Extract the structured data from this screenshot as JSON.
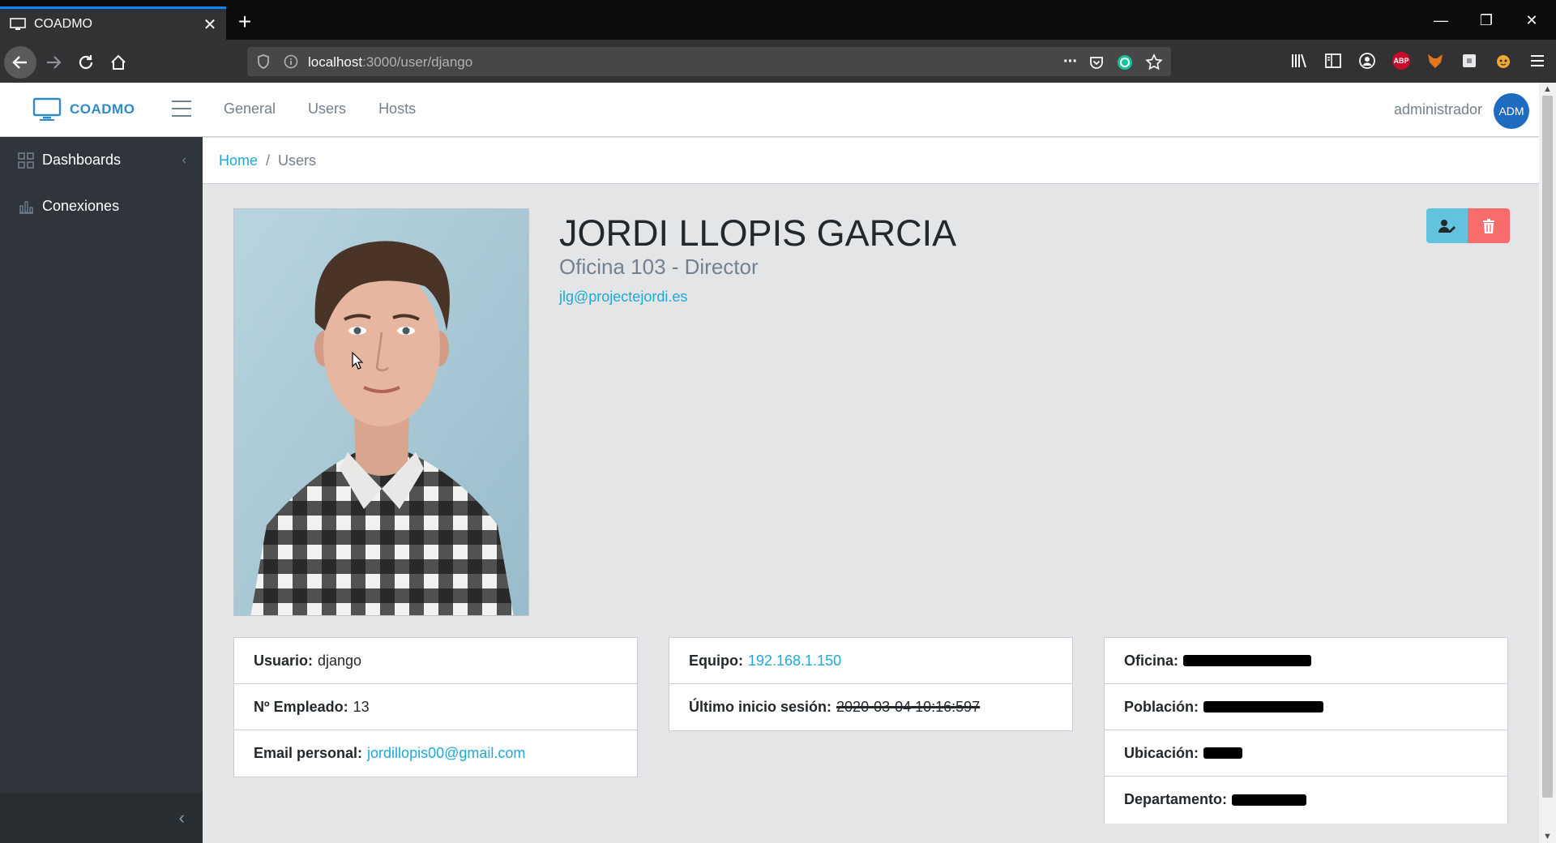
{
  "browser": {
    "tab_title": "COADMO",
    "tab_close": "✕",
    "new_tab": "+",
    "url_host": "localhost",
    "url_path": ":3000/user/django",
    "url_more": "···",
    "abp_label": "ABP",
    "window_minimize": "—",
    "window_restore": "❐",
    "window_close": "✕"
  },
  "header": {
    "brand": "COADMO",
    "nav": [
      "General",
      "Users",
      "Hosts"
    ],
    "user_name": "administrador",
    "avatar_initials": "ADM"
  },
  "sidebar": {
    "items": [
      {
        "label": "Dashboards",
        "icon": "grid-icon",
        "caret": "‹"
      },
      {
        "label": "Conexiones",
        "icon": "bar-chart-icon"
      }
    ],
    "collapse": "‹"
  },
  "breadcrumb": {
    "home": "Home",
    "separator": "/",
    "current": "Users"
  },
  "profile": {
    "name": "JORDI LLOPIS GARCIA",
    "role": "Oficina 103 - Director",
    "email": "jlg@projectejordi.es"
  },
  "cards": {
    "personal": {
      "usuario_label": "Usuario:",
      "usuario_value": "django",
      "empleado_label": "Nº Empleado:",
      "empleado_value": "13",
      "email_label": "Email personal:",
      "email_value": "jordillopis00@gmail.com"
    },
    "equipo": {
      "equipo_label": "Equipo:",
      "equipo_value": "192.168.1.150",
      "sesion_label": "Último inicio sesión:",
      "sesion_value": "2020-03-04 10:16:597"
    },
    "oficina": {
      "oficina_label": "Oficina:",
      "poblacion_label": "Población:",
      "ubicacion_label": "Ubicación:",
      "departamento_label": "Departamento:"
    }
  },
  "colors": {
    "accent": "#20a8d8",
    "sidebar": "#2f353a",
    "edit_button": "#63c2de",
    "delete_button": "#f86c6b",
    "avatar": "#1e6bbf"
  }
}
